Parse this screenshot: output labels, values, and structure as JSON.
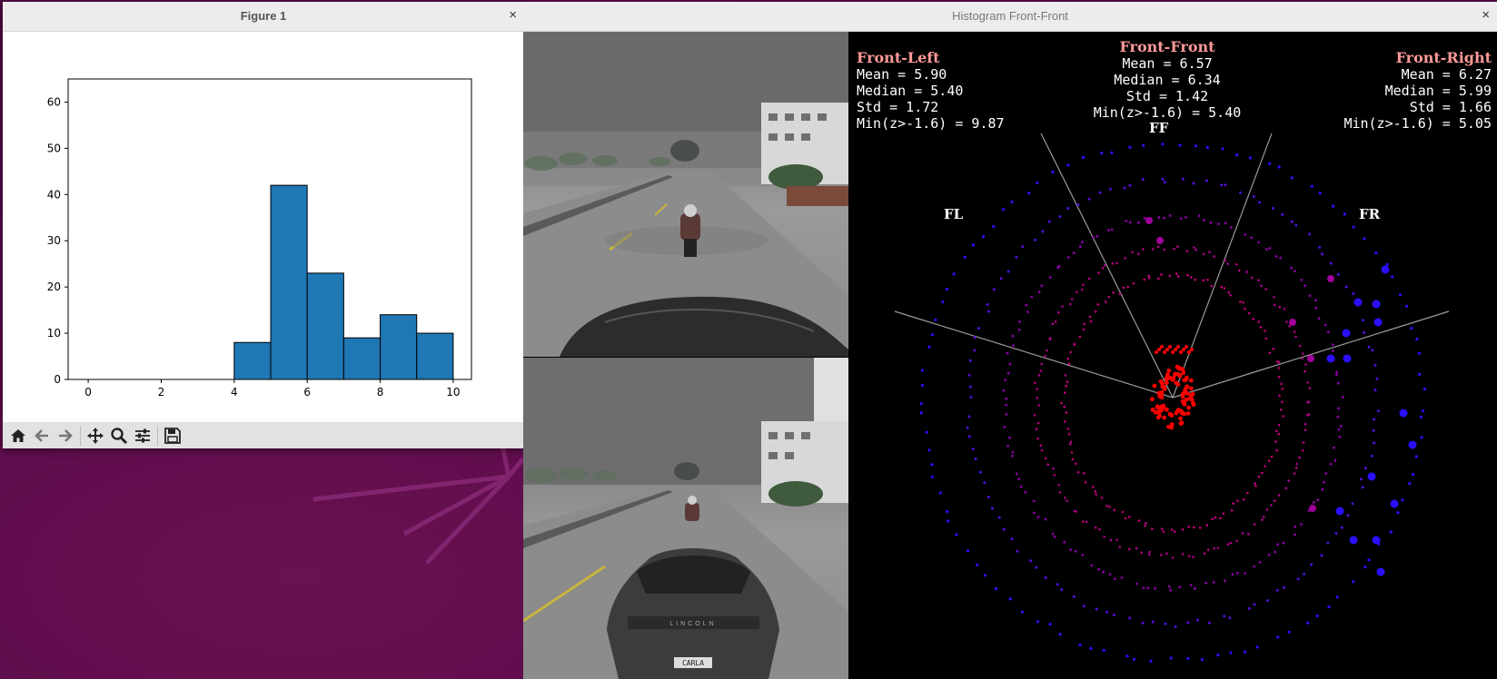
{
  "figure_window": {
    "title": "Figure 1",
    "close_glyph": "×",
    "toolbar": {
      "buttons": [
        "home-icon",
        "back-arrow-icon",
        "forward-arrow-icon",
        "pan-icon",
        "zoom-icon",
        "configure-subplots-icon",
        "save-icon"
      ]
    }
  },
  "chart_data": {
    "type": "bar",
    "title": "",
    "xlabel": "",
    "ylabel": "",
    "x_ticks": [
      "0",
      "2",
      "4",
      "6",
      "8",
      "10"
    ],
    "y_ticks": [
      "0",
      "10",
      "20",
      "30",
      "40",
      "50",
      "60"
    ],
    "xlim": [
      -0.55,
      10.5
    ],
    "ylim": [
      0,
      65
    ],
    "bins": [
      {
        "x0": 4.0,
        "x1": 5.0,
        "count": 8
      },
      {
        "x0": 5.0,
        "x1": 6.0,
        "count": 42
      },
      {
        "x0": 6.0,
        "x1": 7.0,
        "count": 23
      },
      {
        "x0": 7.0,
        "x1": 8.0,
        "count": 9
      },
      {
        "x0": 8.0,
        "x1": 9.0,
        "count": 14
      },
      {
        "x0": 9.0,
        "x1": 10.0,
        "count": 10
      }
    ],
    "bar_color": "#1f77b4",
    "grid": false
  },
  "histogram_window": {
    "title": "Histogram Front-Front",
    "close_glyph": "×",
    "front_left": {
      "head": "Front-Left",
      "lines": [
        "Mean = 5.90",
        "Median = 5.40",
        "Std = 1.72",
        "Min(z>-1.6) = 9.87"
      ]
    },
    "front_front": {
      "head": "Front-Front",
      "lines": [
        "Mean = 6.57",
        "Median = 6.34",
        "Std = 1.42",
        "Min(z>-1.6) = 5.40"
      ]
    },
    "front_right": {
      "head": "Front-Right",
      "lines": [
        "Mean = 6.27",
        "Median = 5.99",
        "Std = 1.66",
        "Min(z>-1.6) = 5.05"
      ]
    },
    "zones": {
      "fl": "FL",
      "ff": "FF",
      "fr": "FR"
    },
    "colors": {
      "near": "#ff0000",
      "mid": "#a0009a",
      "far": "#2a10ff",
      "guide": "#9a9a9a"
    },
    "plate_text": "CARLA"
  }
}
